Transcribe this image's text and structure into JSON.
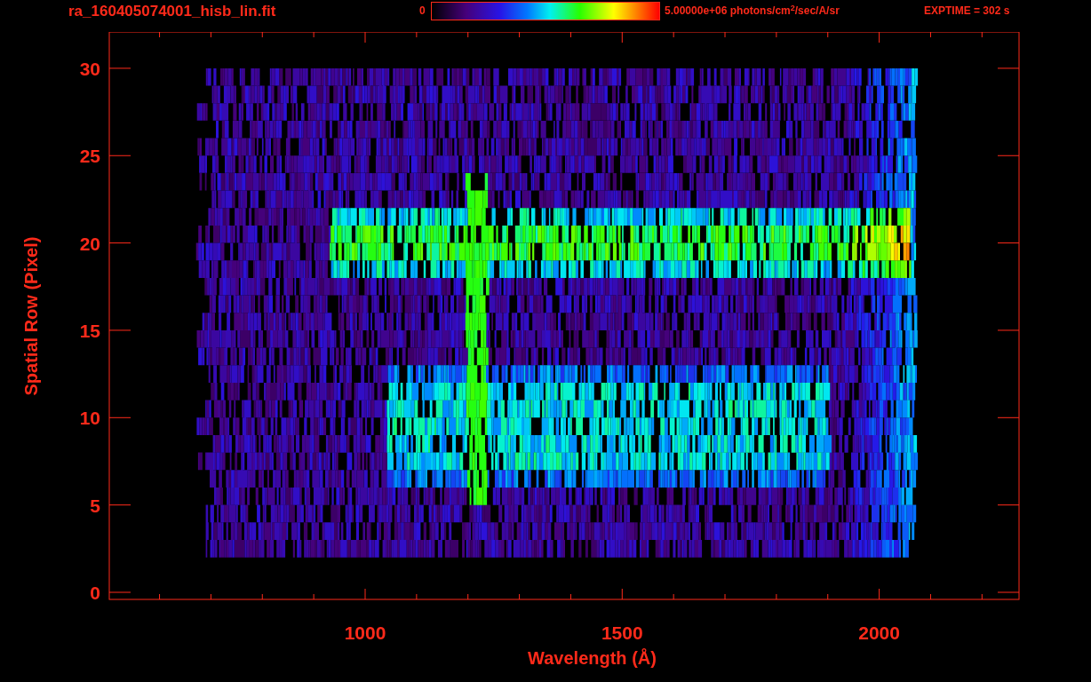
{
  "title": "ra_160405074001_hisb_lin.fit",
  "colorbar": {
    "min_label": "0",
    "max_label": "5.00000e+06 photons/cm$^{2}$/sec/A/sr"
  },
  "exptime": "EXPTIME = 302 s",
  "plot": {
    "xlabel": "Wavelength (Å)",
    "ylabel": "Spatial Row (Pixel)",
    "xticks": [
      "1000",
      "1500",
      "2000"
    ],
    "yticks": [
      "30",
      "25",
      "20",
      "15",
      "10",
      "5",
      "0"
    ]
  }
}
